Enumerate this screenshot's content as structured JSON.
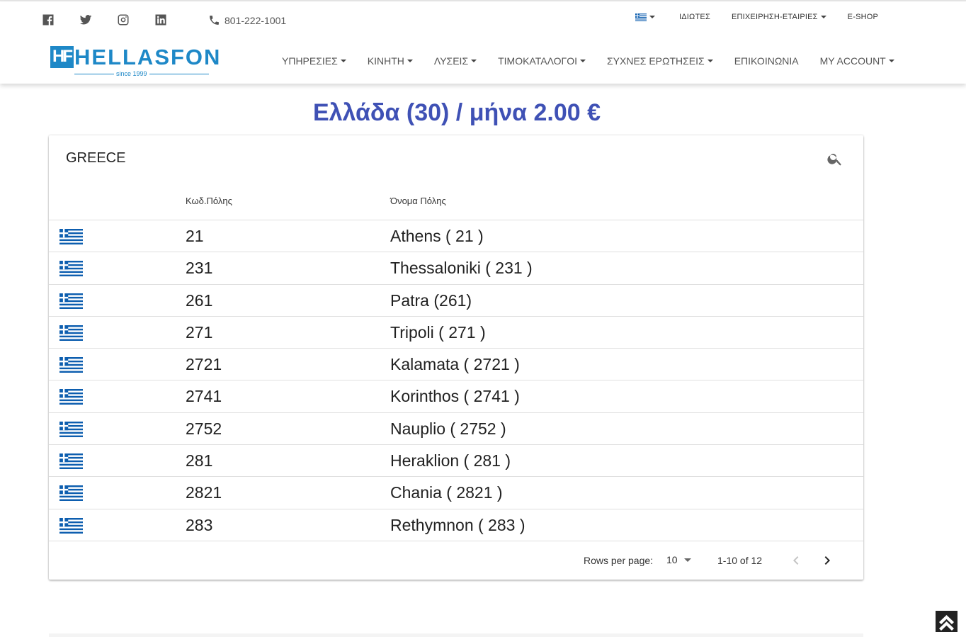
{
  "header": {
    "phone": "801-222-1001",
    "social": [
      "facebook-icon",
      "twitter-icon",
      "instagram-icon",
      "linkedin-icon"
    ],
    "utility_nav": [
      "ΙΔΙΩΤΕΣ",
      "ΕΠΙΧΕΙΡΗΣΗ-ΕΤΑΙΡΙΕΣ",
      "E-SHOP"
    ],
    "logo": {
      "mark": "HF",
      "name": "HELLASFON",
      "since": "since 1999"
    },
    "main_nav": [
      "ΥΠΗΡΕΣΙΕΣ",
      "ΚΙΝΗΤΗ",
      "ΛΥΣΕΙΣ",
      "ΤΙΜΟΚΑΤΑΛΟΓΟΙ",
      "ΣΥΧΝΕΣ ΕΡΩΤΗΣΕΙΣ",
      "ΕΠΙΚΟΙΝΩΝΙΑ",
      "MY ACCOUNT"
    ]
  },
  "page": {
    "title": "Ελλάδα (30) / μήνα 2.00 €"
  },
  "table": {
    "title": "GREECE",
    "headers": {
      "code": "Κωδ.Πόλης",
      "name": "Όνομα Πόλης"
    },
    "rows": [
      {
        "code": "21",
        "name": "Athens ( 21 )"
      },
      {
        "code": "231",
        "name": "Thessaloniki ( 231 )"
      },
      {
        "code": "261",
        "name": "Patra (261)"
      },
      {
        "code": "271",
        "name": "Tripoli ( 271 )"
      },
      {
        "code": "2721",
        "name": "Kalamata ( 2721 )"
      },
      {
        "code": "2741",
        "name": "Korinthos ( 2741 )"
      },
      {
        "code": "2752",
        "name": "Nauplio ( 2752 )"
      },
      {
        "code": "281",
        "name": "Heraklion ( 281 )"
      },
      {
        "code": "2821",
        "name": "Chania ( 2821 )"
      },
      {
        "code": "283",
        "name": "Rethymnon ( 283 )"
      }
    ],
    "footer": {
      "rows_per_page_label": "Rows per page:",
      "rows_per_page_value": "10",
      "range": "1-10 of 12"
    }
  },
  "colors": {
    "brand": "#1e88c7",
    "title": "#3f51b5",
    "flag_blue": "#0d5eaf"
  }
}
